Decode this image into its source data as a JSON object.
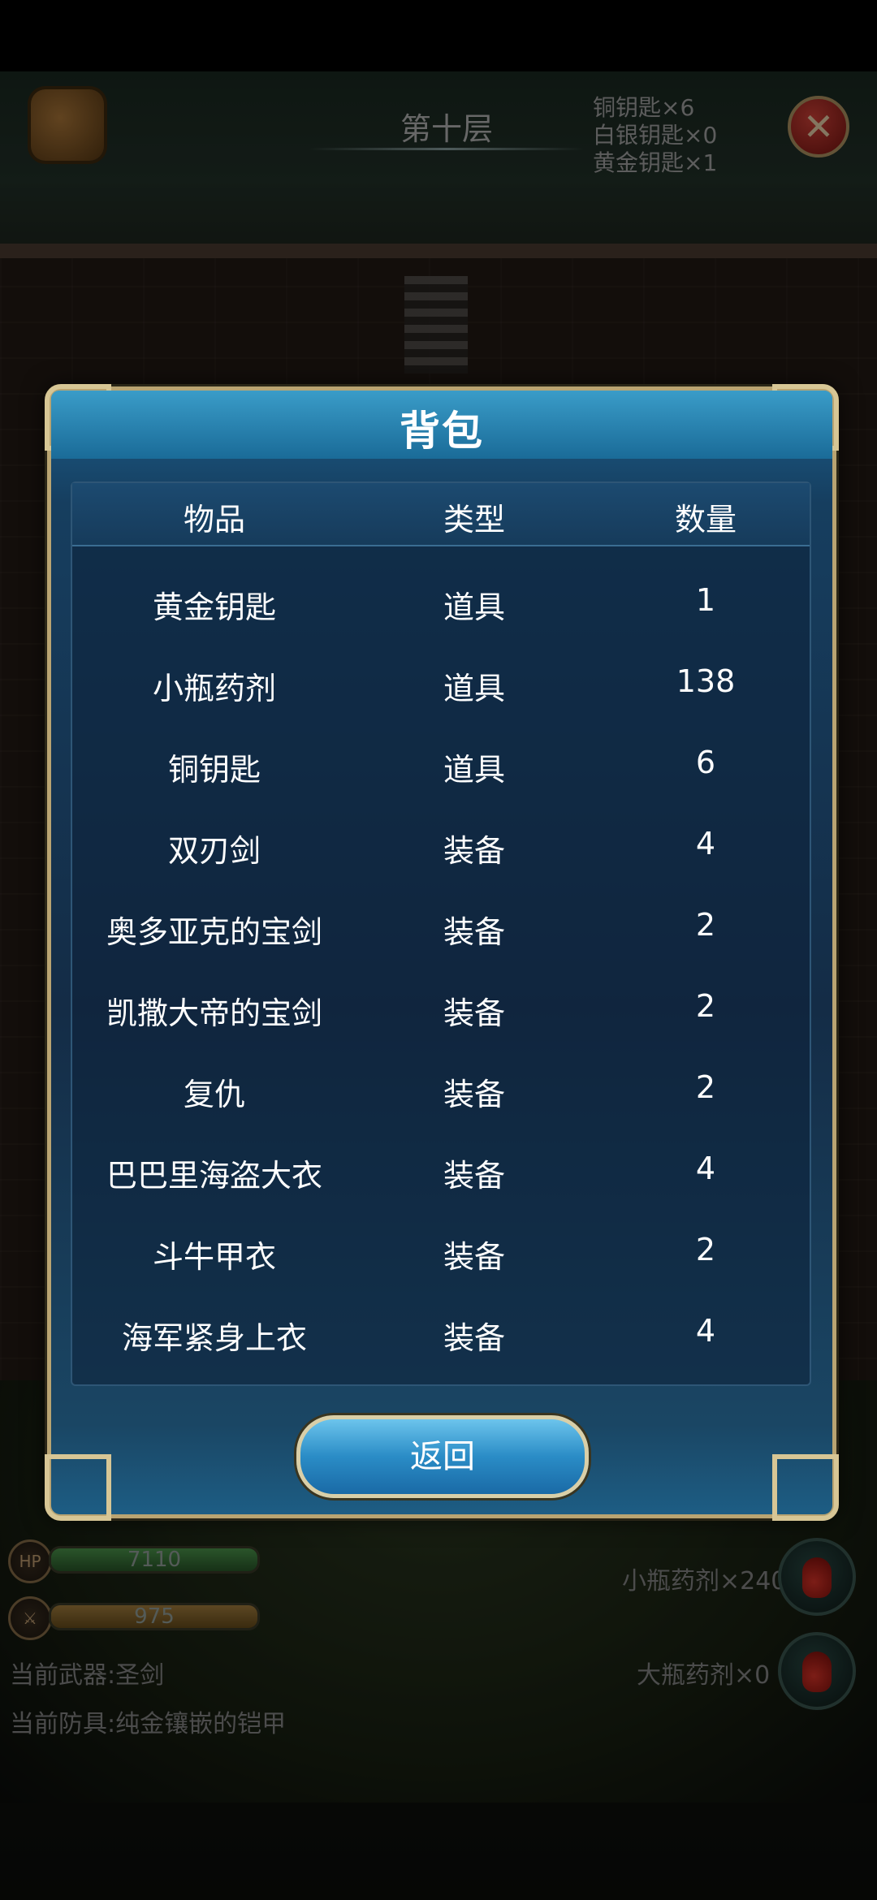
{
  "hud": {
    "floor_title": "第十层",
    "keys": [
      "铜钥匙×6",
      "白银钥匙×0",
      "黄金钥匙×1"
    ],
    "hp_label": "HP",
    "hp_value": "7110",
    "attack_value": "975",
    "current_weapon": "当前武器:圣剑",
    "current_armor": "当前防具:纯金镶嵌的铠甲",
    "small_potion": "小瓶药剂×240",
    "large_potion": "大瓶药剂×0",
    "close_symbol": "✕"
  },
  "dialog": {
    "title": "背包",
    "columns": [
      "物品",
      "类型",
      "数量"
    ],
    "rows": [
      {
        "name": "黄金钥匙",
        "type": "道具",
        "qty": "1"
      },
      {
        "name": "小瓶药剂",
        "type": "道具",
        "qty": "138"
      },
      {
        "name": "铜钥匙",
        "type": "道具",
        "qty": "6"
      },
      {
        "name": "双刃剑",
        "type": "装备",
        "qty": "4"
      },
      {
        "name": "奥多亚克的宝剑",
        "type": "装备",
        "qty": "2"
      },
      {
        "name": "凯撒大帝的宝剑",
        "type": "装备",
        "qty": "2"
      },
      {
        "name": "复仇",
        "type": "装备",
        "qty": "2"
      },
      {
        "name": "巴巴里海盗大衣",
        "type": "装备",
        "qty": "4"
      },
      {
        "name": "斗牛甲衣",
        "type": "装备",
        "qty": "2"
      },
      {
        "name": "海军紧身上衣",
        "type": "装备",
        "qty": "4"
      }
    ],
    "back_label": "返回"
  },
  "colors": {
    "hp_bar": "#3a7a3a",
    "attack_bar": "#8a6a2a",
    "dialog_border": "#b9a472",
    "button_blue": "#2a8cc6"
  }
}
